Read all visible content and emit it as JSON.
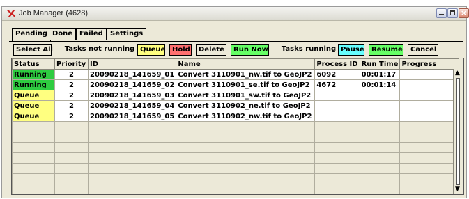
{
  "window": {
    "title": "Job Manager (4628)",
    "controls": {
      "close": "×"
    }
  },
  "tabs": [
    "Pending",
    "Done",
    "Failed",
    "Settings"
  ],
  "toolbar": {
    "select_all": "Select All",
    "not_running_label": "Tasks not running",
    "queue": "Queue",
    "hold": "Hold",
    "delete": "Delete",
    "run_now": "Run Now",
    "running_label": "Tasks running",
    "pause": "Pause",
    "resume": "Resume",
    "cancel": "Cancel"
  },
  "colors": {
    "running": "#2ecc40",
    "queue": "#ffff80",
    "hold": "#ff7070",
    "run_now": "#66ff66",
    "pause": "#66ffff",
    "resume": "#66ff66"
  },
  "table": {
    "columns": [
      "Status",
      "Priority",
      "ID",
      "Name",
      "Process ID",
      "Run Time",
      "Progress"
    ],
    "rows": [
      [
        "Running",
        "2",
        "20090218_141659_01",
        "Convert 3110901_nw.tif to GeoJP2",
        "6092",
        "00:01:17",
        ""
      ],
      [
        "Running",
        "2",
        "20090218_141659_02",
        "Convert 3110901_se.tif to GeoJP2",
        "4672",
        "00:01:14",
        ""
      ],
      [
        "Queue",
        "2",
        "20090218_141659_03",
        "Convert 3110901_sw.tif to GeoJP2",
        "",
        "",
        ""
      ],
      [
        "Queue",
        "2",
        "20090218_141659_04",
        "Convert 3110902_ne.tif to GeoJP2",
        "",
        "",
        ""
      ],
      [
        "Queue",
        "2",
        "20090218_141659_05",
        "Convert 3110902_nw.tif to GeoJP2",
        "",
        "",
        ""
      ]
    ],
    "empty_rows": 7
  }
}
